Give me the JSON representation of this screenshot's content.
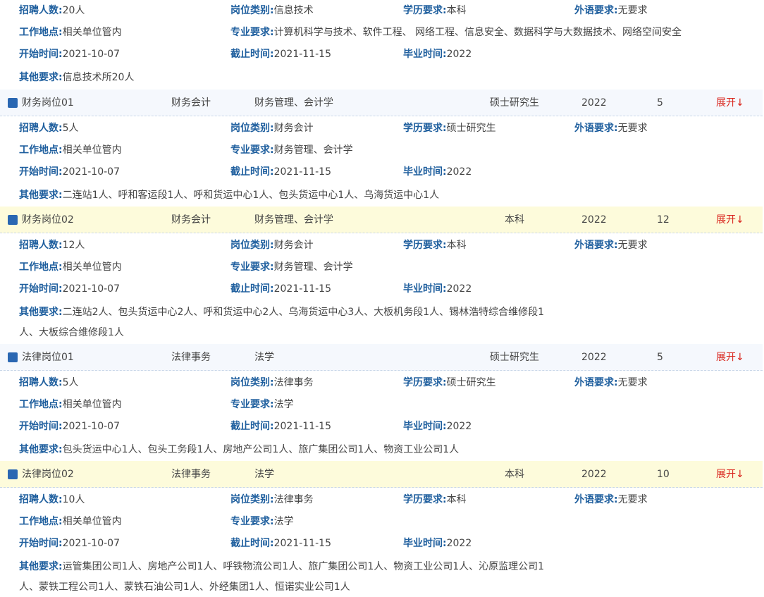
{
  "labels": {
    "count": "招聘人数:",
    "category": "岗位类别:",
    "education": "学历要求:",
    "language": "外语要求:",
    "location": "工作地点:",
    "major": "专业要求:",
    "start": "开始时间:",
    "end": "截止时间:",
    "graduation": "毕业时间:",
    "other": "其他要求:"
  },
  "top_detail": {
    "count": "20人",
    "category": "信息技术",
    "education": "本科",
    "language": "无要求",
    "location": "相关单位管内",
    "major": "计算机科学与技术、软件工程、 网络工程、信息安全、数据科学与大数据技术、网络空间安全",
    "start": "2021-10-07",
    "end": "2021-11-15",
    "graduation": "2022",
    "other_lines": [
      "信息技术所20人"
    ]
  },
  "positions": [
    {
      "name": "财务岗位01",
      "category": "财务会计",
      "major": "财务管理、会计学",
      "education": "硕士研究生",
      "year": "2022",
      "count": "5",
      "toggle": "展开↓",
      "detail": {
        "count": "5人",
        "category": "财务会计",
        "education": "硕士研究生",
        "language": "无要求",
        "location": "相关单位管内",
        "major": "财务管理、会计学",
        "start": "2021-10-07",
        "end": "2021-11-15",
        "graduation": "2022",
        "other_lines": [
          "二连站1人、呼和客运段1人、呼和货运中心1人、包头货运中心1人、乌海货运中心1人"
        ]
      }
    },
    {
      "name": "财务岗位02",
      "category": "财务会计",
      "major": "财务管理、会计学",
      "education": "本科",
      "year": "2022",
      "count": "12",
      "toggle": "展开↓",
      "detail": {
        "count": "12人",
        "category": "财务会计",
        "education": "本科",
        "language": "无要求",
        "location": "相关单位管内",
        "major": "财务管理、会计学",
        "start": "2021-10-07",
        "end": "2021-11-15",
        "graduation": "2022",
        "other_lines": [
          "二连站2人、包头货运中心2人、呼和货运中心2人、乌海货运中心3人、大板机务段1人、锡林浩特综合维修段1",
          "人、大板综合维修段1人"
        ]
      }
    },
    {
      "name": "法律岗位01",
      "category": "法律事务",
      "major": "法学",
      "education": "硕士研究生",
      "year": "2022",
      "count": "5",
      "toggle": "展开↓",
      "detail": {
        "count": "5人",
        "category": "法律事务",
        "education": "硕士研究生",
        "language": "无要求",
        "location": "相关单位管内",
        "major": "法学",
        "start": "2021-10-07",
        "end": "2021-11-15",
        "graduation": "2022",
        "other_lines": [
          "包头货运中心1人、包头工务段1人、房地产公司1人、旅广集团公司1人、物资工业公司1人"
        ]
      }
    },
    {
      "name": "法律岗位02",
      "category": "法律事务",
      "major": "法学",
      "education": "本科",
      "year": "2022",
      "count": "10",
      "toggle": "展开↓",
      "detail": {
        "count": "10人",
        "category": "法律事务",
        "education": "本科",
        "language": "无要求",
        "location": "相关单位管内",
        "major": "法学",
        "start": "2021-10-07",
        "end": "2021-11-15",
        "graduation": "2022",
        "other_lines": [
          "运管集团公司1人、房地产公司1人、呼铁物流公司1人、旅广集团公司1人、物资工业公司1人、沁原监理公司1",
          "人、蒙铁工程公司1人、蒙铁石油公司1人、外经集团1人、恒诺实业公司1人"
        ]
      }
    }
  ]
}
